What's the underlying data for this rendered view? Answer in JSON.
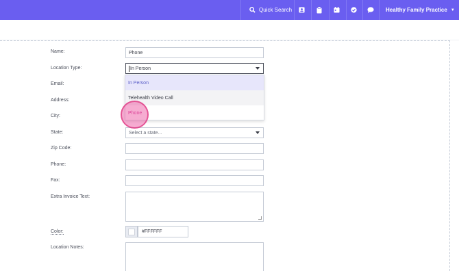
{
  "topbar": {
    "quick_search": "Quick Search",
    "practice_name": "Healthy Family Practice",
    "icons": [
      "contacts-icon",
      "clipboard-icon",
      "calendar-icon",
      "check-circle-icon",
      "chat-icon"
    ]
  },
  "form": {
    "name_label": "Name:",
    "name_value": "Phone",
    "location_type_label": "Location Type:",
    "location_type_value": "In Person",
    "email_label": "Email:",
    "address_label": "Address:",
    "city_label": "City:",
    "state_label": "State:",
    "state_placeholder": "Select a state...",
    "zip_label": "Zip Code:",
    "phone_label": "Phone:",
    "fax_label": "Fax:",
    "invoice_label": "Extra Invoice Text:",
    "color_label": "Color:",
    "color_value": "#FFFFFF",
    "notes_label": "Location Notes:"
  },
  "dropdown": {
    "options": [
      "In Person",
      "Telehealth Video Call",
      "Phone"
    ]
  },
  "colors": {
    "topbar": "#6a5ef0",
    "highlight": "#e7e6fb",
    "cursor": "#ec4899"
  }
}
